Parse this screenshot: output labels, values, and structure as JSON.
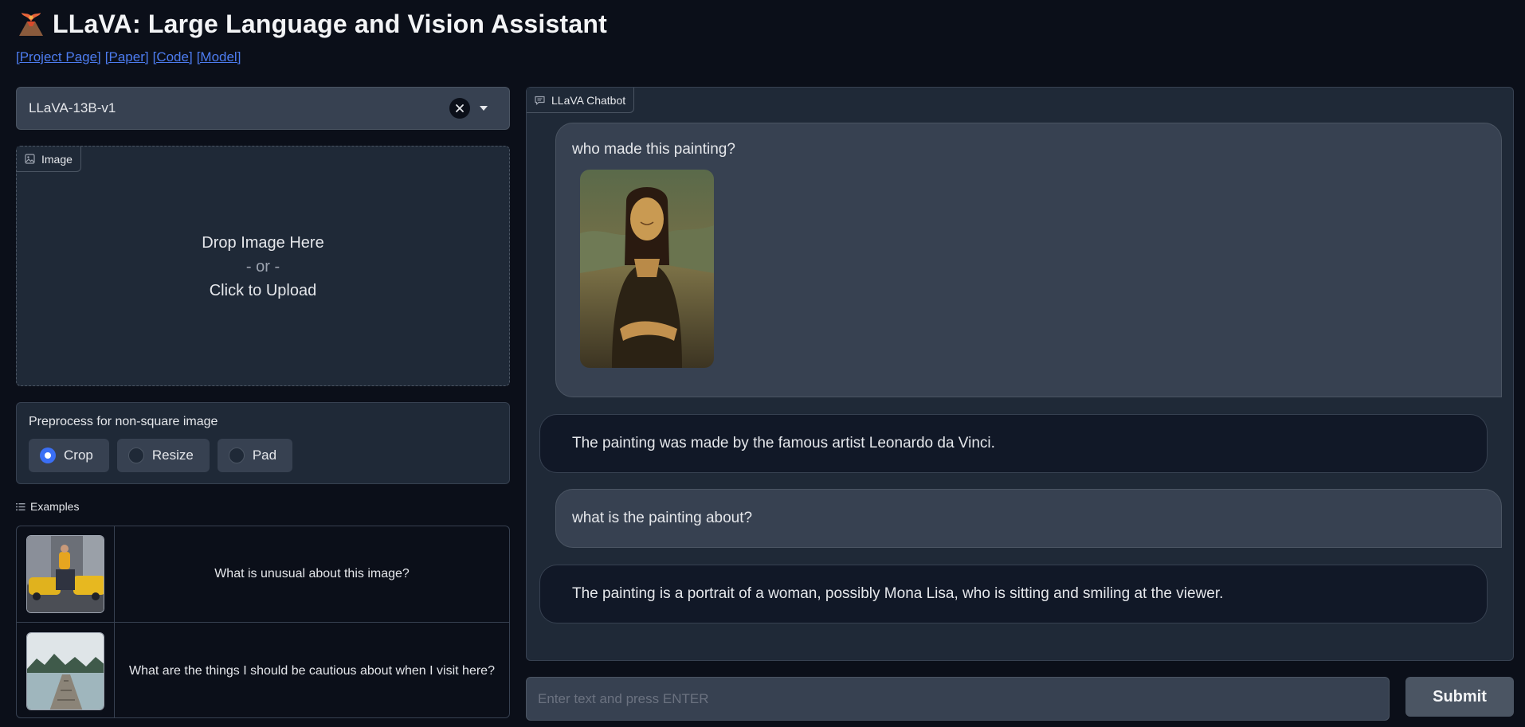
{
  "header": {
    "title": "LLaVA: Large Language and Vision Assistant",
    "links": [
      "[Project Page]",
      "[Paper]",
      "[Code]",
      "[Model]"
    ]
  },
  "model_dropdown": {
    "value": "LLaVA-13B-v1"
  },
  "image_upload": {
    "label": "Image",
    "drop_text": "Drop Image Here",
    "or_text": "- or -",
    "click_text": "Click to Upload"
  },
  "preprocess": {
    "label": "Preprocess for non-square image",
    "options": [
      "Crop",
      "Resize",
      "Pad"
    ],
    "selected": "Crop"
  },
  "examples": {
    "label": "Examples",
    "items": [
      {
        "text": "What is unusual about this image?"
      },
      {
        "text": "What are the things I should be cautious about when I visit here?"
      }
    ]
  },
  "chatbot": {
    "label": "LLaVA Chatbot",
    "messages": [
      {
        "role": "user",
        "text": "who made this painting?"
      },
      {
        "role": "bot",
        "text": "The painting was made by the famous artist Leonardo da Vinci."
      },
      {
        "role": "user",
        "text": "what is the painting about?"
      },
      {
        "role": "bot",
        "text": "The painting is a portrait of a woman, possibly Mona Lisa, who is sitting and smiling at the viewer."
      }
    ]
  },
  "input": {
    "placeholder": "Enter text and press ENTER",
    "value": ""
  },
  "submit": {
    "label": "Submit"
  },
  "colors": {
    "background": "#0b0f19",
    "panel": "#1f2937",
    "accent": "#3b6ff5",
    "link": "#4d7cf0"
  }
}
